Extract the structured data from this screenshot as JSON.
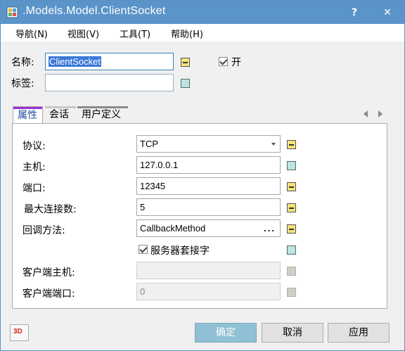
{
  "window": {
    "title": ".Models.Model.ClientSocket",
    "help_glyph": "?",
    "close_glyph": "✕"
  },
  "menu": [
    {
      "label": "导航(N)"
    },
    {
      "label": "视图(V)"
    },
    {
      "label": "工具(T)"
    },
    {
      "label": "帮助(H)"
    }
  ],
  "header": {
    "name_label": "名称:",
    "name_value": "ClientSocket",
    "tag_label": "标签:",
    "tag_value": "",
    "open_label": "开",
    "open_checked": true
  },
  "tabs": [
    {
      "label": "属性",
      "active": true,
      "color": "#9b30d9"
    },
    {
      "label": "会话",
      "active": false,
      "color": "#c8c8c8"
    },
    {
      "label": "用户定义",
      "active": false,
      "color": "#8a8a8a"
    }
  ],
  "properties": {
    "protocol_label": "协议:",
    "protocol_value": "TCP",
    "host_label": "主机:",
    "host_value": "127.0.0.1",
    "port_label": "端口:",
    "port_value": "12345",
    "max_conn_label": "最大连接数:",
    "max_conn_value": "5",
    "callback_label": "回调方法:",
    "callback_value": "CallbackMethod",
    "callback_ellipsis": "...",
    "server_socket_label": "服务器套接字",
    "server_socket_checked": true,
    "client_host_label": "客户端主机:",
    "client_host_value": "",
    "client_port_label": "客户端端口:",
    "client_port_value": "0"
  },
  "footer": {
    "icon_text": "3D",
    "ok_label": "确定",
    "cancel_label": "取消",
    "apply_label": "应用"
  }
}
